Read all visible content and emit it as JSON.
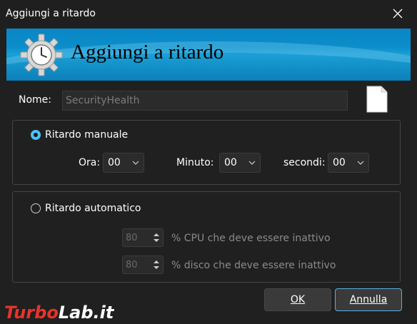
{
  "window": {
    "title": "Aggiungi a ritardo"
  },
  "banner": {
    "title": "Aggiungi a ritardo"
  },
  "name": {
    "label": "Nome:",
    "value": "SecurityHealth"
  },
  "manual": {
    "label": "Ritardo manuale",
    "selected": true,
    "hour_label": "Ora:",
    "hour_value": "00",
    "minute_label": "Minuto:",
    "minute_value": "00",
    "seconds_label": "secondi:",
    "seconds_value": "00"
  },
  "automatic": {
    "label": "Ritardo automatico",
    "selected": false,
    "cpu_value": "80",
    "cpu_label": "% CPU che deve essere inattivo",
    "disk_value": "80",
    "disk_label": "% disco che deve essere inattivo"
  },
  "buttons": {
    "ok": "OK",
    "cancel": "Annulla"
  },
  "watermark": {
    "part1": "Turbo",
    "part2": "Lab.it"
  },
  "colors": {
    "accent": "#4cc2ff",
    "banner": "#0b8ec9",
    "background": "#202020"
  }
}
